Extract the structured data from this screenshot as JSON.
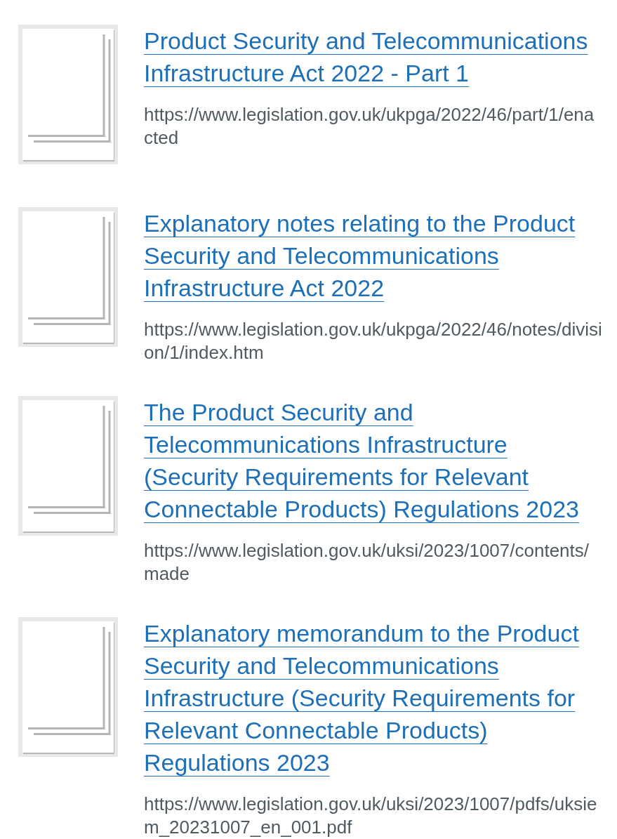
{
  "attachments": [
    {
      "title": "Product Security and Telecommunications Infrastructure Act 2022 - Part 1",
      "url": "https://www.legislation.gov.uk/ukpga/2022/46/part/1/enacted"
    },
    {
      "title": "Explanatory notes relating to the Product Security and Telecommunications Infrastructure Act 2022",
      "url": "https://www.legislation.gov.uk/ukpga/2022/46/notes/division/1/index.htm"
    },
    {
      "title": "The Product Security and Telecommunications Infrastructure (Security Requirements for Relevant Connectable Products) Regulations 2023",
      "url": "https://www.legislation.gov.uk/uksi/2023/1007/contents/made"
    },
    {
      "title": "Explanatory memorandum to the Product Security and Telecommunications Infrastructure (Security Requirements for Relevant Connectable Products) Regulations 2023",
      "url": "https://www.legislation.gov.uk/uksi/2023/1007/pdfs/uksiem_20231007_en_001.pdf"
    }
  ]
}
